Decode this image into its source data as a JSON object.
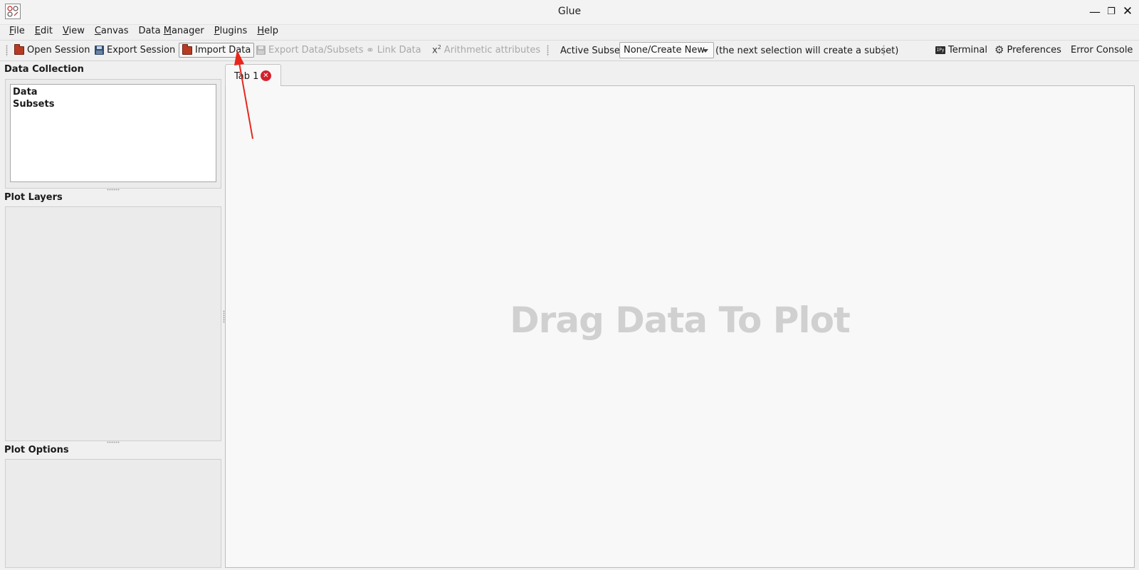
{
  "window": {
    "title": "Glue"
  },
  "menu": [
    {
      "mnemonic": "F",
      "rest": "ile"
    },
    {
      "mnemonic": "E",
      "rest": "dit"
    },
    {
      "mnemonic": "V",
      "rest": "iew"
    },
    {
      "mnemonic": "C",
      "rest": "anvas"
    },
    {
      "pre": "Data ",
      "mnemonic": "M",
      "rest": "anager"
    },
    {
      "mnemonic": "P",
      "rest": "lugins"
    },
    {
      "mnemonic": "H",
      "rest": "elp"
    }
  ],
  "toolbar": {
    "open_session": "Open Session",
    "export_session": "Export Session",
    "import_data": "Import Data",
    "export_data_subsets": "Export Data/Subsets",
    "link_data": "Link Data",
    "arithmetic_attributes": "Arithmetic attributes",
    "active_subset_label": "Active Subset:",
    "active_subset_value": "None/Create New",
    "subset_hint": "(the next selection will create a subset)",
    "terminal": "Terminal",
    "preferences": "Preferences",
    "error_console": "Error Console",
    "terminal_icon_text": "IPy"
  },
  "panels": {
    "data_collection": {
      "title": "Data Collection",
      "items": [
        "Data",
        "Subsets"
      ]
    },
    "plot_layers": {
      "title": "Plot Layers"
    },
    "plot_options": {
      "title": "Plot Options"
    }
  },
  "tabs": [
    {
      "label": "Tab 1"
    }
  ],
  "canvas": {
    "hint": "Drag Data To Plot"
  },
  "colors": {
    "tab_close": "#d2222d",
    "annotation_arrow": "#e8261c",
    "canvas_hint": "#d0d0d0"
  },
  "icons": {
    "open_session": "folder-icon",
    "export_session": "disk-icon",
    "import_data": "folder-icon",
    "export_data_subsets": "disk-icon",
    "link_data": "link-icon",
    "arithmetic_attributes": "x-squared-icon",
    "terminal": "terminal-icon",
    "preferences": "gear-icon"
  }
}
